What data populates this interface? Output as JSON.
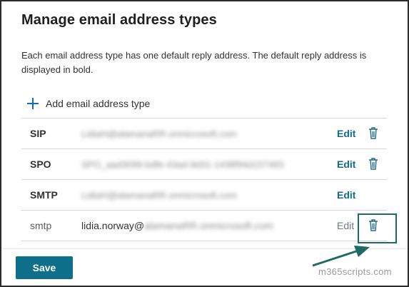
{
  "panel": {
    "title": "Manage email address types",
    "description": "Each email address type has one default reply address. The default reply address is displayed in bold."
  },
  "add_button": {
    "label": "Add email address type",
    "icon": "plus-icon"
  },
  "rows": [
    {
      "type": "SIP",
      "address": "LidiaH@alamanaRR.onmicrosoft.com",
      "address_redacted": true,
      "edit_label": "Edit",
      "default": true
    },
    {
      "type": "SPO",
      "address": "SPO_aad3099-bdfe-43ad-9d31-1438f94d157493",
      "address_redacted": true,
      "edit_label": "Edit",
      "default": true
    },
    {
      "type": "SMTP",
      "address": "LidiaH@alamanaRR.onmicrosoft.com",
      "address_redacted": true,
      "edit_label": "Edit",
      "default": true
    },
    {
      "type": "smtp",
      "address_prefix": "lidia.norway@",
      "address_suffix": "alamanaRR.onmicrosoft.com",
      "edit_label": "Edit",
      "default": false
    }
  ],
  "footer": {
    "save_label": "Save"
  },
  "watermark": "m365scripts.com",
  "colors": {
    "accent": "#0d6f8a",
    "link": "#0f6c8d",
    "highlight": "#1e6b63",
    "plus": "#0f6cbd"
  }
}
